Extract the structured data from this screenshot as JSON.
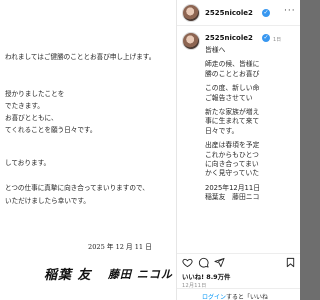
{
  "letter": {
    "lines": [
      "われましてはご健勝のこととお喜び申し上げます。",
      "授かりましたことを",
      "でたきます。",
      "お喜びとともに、",
      "てくれることを願う日々です。",
      "しております。",
      "とつの仕事に真摯に向き合ってまいりますので、",
      "いただけましたら幸いです。"
    ],
    "date": "2025 年 12 月 11 日",
    "signature_left": "稲葉 友",
    "signature_right": "藤田 ニコル"
  },
  "post": {
    "username": "2525nicole2",
    "caption_username": "2525nicole2",
    "caption_time": "1日",
    "caption_lines": [
      "皆様へ",
      "",
      "師走の候、皆様に",
      "勝のこととお喜び",
      "",
      "この度、新しい命",
      "ご報告させてい",
      "",
      "新たな家族が増え",
      "事に生まれて来て",
      "日々です。",
      "",
      "出産は春頃を予定",
      "これからもひとつ",
      "に向き合ってまい",
      "かく見守っていた",
      "",
      "2025年12月11日",
      "稲葉友　藤田ニコ"
    ],
    "likes": "いいね! 8.9万件",
    "date": "12月11日",
    "login_link": "ログイン",
    "login_text": "すると「いいね",
    "colors": {
      "link": "#0095f6",
      "verified": "#3897f0"
    }
  }
}
